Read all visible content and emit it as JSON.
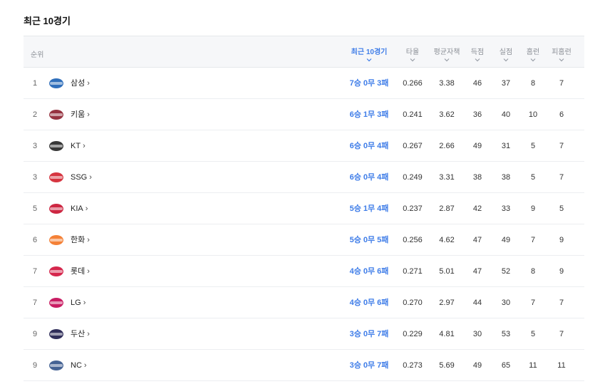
{
  "section_title": "최근 10경기",
  "columns": {
    "rank": "순위",
    "recent": "최근 10경기",
    "avg": "타율",
    "era": "평균자책",
    "rs": "득점",
    "ra": "실점",
    "hr": "홈런",
    "hra": "피홈런"
  },
  "colors": {
    "accent": "#3f7de8",
    "header_bg": "#f6f7f9",
    "row_border": "#eceef1"
  },
  "rows": [
    {
      "rank": "1",
      "team": "삼성",
      "logo": "samsung-lions-logo-icon",
      "logo_color": "#1a5fb4",
      "recent": "7승 0무 3패",
      "avg": "0.266",
      "era": "3.38",
      "rs": "46",
      "ra": "37",
      "hr": "8",
      "hra": "7"
    },
    {
      "rank": "2",
      "team": "키움",
      "logo": "kiwoom-heroes-logo-icon",
      "logo_color": "#8b1d2c",
      "recent": "6승 1무 3패",
      "avg": "0.241",
      "era": "3.62",
      "rs": "36",
      "ra": "40",
      "hr": "10",
      "hra": "6"
    },
    {
      "rank": "3",
      "team": "KT",
      "logo": "kt-wiz-logo-icon",
      "logo_color": "#222222",
      "recent": "6승 0무 4패",
      "avg": "0.267",
      "era": "2.66",
      "rs": "49",
      "ra": "31",
      "hr": "5",
      "hra": "7"
    },
    {
      "rank": "3",
      "team": "SSG",
      "logo": "ssg-landers-logo-icon",
      "logo_color": "#d21f2b",
      "recent": "6승 0무 4패",
      "avg": "0.249",
      "era": "3.31",
      "rs": "38",
      "ra": "38",
      "hr": "5",
      "hra": "7"
    },
    {
      "rank": "5",
      "team": "KIA",
      "logo": "kia-tigers-logo-icon",
      "logo_color": "#c8102e",
      "recent": "5승 1무 4패",
      "avg": "0.237",
      "era": "2.87",
      "rs": "42",
      "ra": "33",
      "hr": "9",
      "hra": "5"
    },
    {
      "rank": "6",
      "team": "한화",
      "logo": "hanwha-eagles-logo-icon",
      "logo_color": "#f37321",
      "recent": "5승 0무 5패",
      "avg": "0.256",
      "era": "4.62",
      "rs": "47",
      "ra": "49",
      "hr": "7",
      "hra": "9"
    },
    {
      "rank": "7",
      "team": "롯데",
      "logo": "lotte-giants-logo-icon",
      "logo_color": "#d0103a",
      "recent": "4승 0무 6패",
      "avg": "0.271",
      "era": "5.01",
      "rs": "47",
      "ra": "52",
      "hr": "8",
      "hra": "9"
    },
    {
      "rank": "7",
      "team": "LG",
      "logo": "lg-twins-logo-icon",
      "logo_color": "#c30452",
      "recent": "4승 0무 6패",
      "avg": "0.270",
      "era": "2.97",
      "rs": "44",
      "ra": "30",
      "hr": "7",
      "hra": "7"
    },
    {
      "rank": "9",
      "team": "두산",
      "logo": "doosan-bears-logo-icon",
      "logo_color": "#1a1748",
      "recent": "3승 0무 7패",
      "avg": "0.229",
      "era": "4.81",
      "rs": "30",
      "ra": "53",
      "hr": "5",
      "hra": "7"
    },
    {
      "rank": "9",
      "team": "NC",
      "logo": "nc-dinos-logo-icon",
      "logo_color": "#315288",
      "recent": "3승 0무 7패",
      "avg": "0.273",
      "era": "5.69",
      "rs": "49",
      "ra": "65",
      "hr": "11",
      "hra": "11"
    }
  ]
}
